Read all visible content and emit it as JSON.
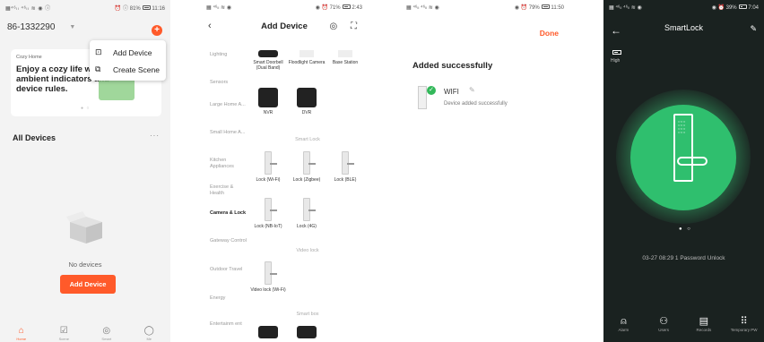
{
  "screen1": {
    "status_left": "▦⁴⁶ₗₗ ⁴⁶ₗₗ ≋ ◉ ⓘ",
    "status_right": "⏰ ⓘ 81%",
    "home_name": "86-1332290",
    "caret": "▼",
    "plus": "+",
    "menu": [
      {
        "icon": "⊡",
        "label": "Add Device"
      },
      {
        "icon": "⧉",
        "label": "Create Scene"
      }
    ],
    "status_time": "11:16",
    "card_tag": "Cozy Home",
    "card_text": "Enjoy a cozy life with ambient indicators and device rules.",
    "card_dots": "● ○",
    "all_devices": "All Devices",
    "more": "···",
    "no_devices": "No devices",
    "add_device_btn": "Add Device",
    "tabs": [
      {
        "label": "Home",
        "icon": "⌂"
      },
      {
        "label": "Scene",
        "icon": "☑"
      },
      {
        "label": "Smart",
        "icon": "◎"
      },
      {
        "label": "Me",
        "icon": "◯"
      }
    ]
  },
  "screen2": {
    "status_left": "▦ ⁴⁶ₗₗ ≋ ◉",
    "status_right": "◉ ⏰ 71%",
    "status_time": "2:43",
    "back": "‹",
    "title": "Add Device",
    "icons": "◎ ⛶",
    "categories": [
      "Lighting",
      "Sensors",
      "Large Home A...",
      "Small Home A...",
      "Kitchen Appliances",
      "Exercise & Health",
      "Camera & Lock",
      "Gateway Control",
      "Outdoor Travel",
      "Energy",
      "Entertainm ent"
    ],
    "devices_top": [
      "Smart Doorbell (Dual Band)",
      "Floodlight Camera",
      "Base Station"
    ],
    "devices_cam": [
      "NVR",
      "DVR"
    ],
    "section_smartlock": "Smart Lock",
    "locks_row1": [
      "Lock (Wi-Fi)",
      "Lock (Zigbee)",
      "Lock (BLE)"
    ],
    "locks_row2": [
      "Lock (NB-IoT)",
      "Lock (4G)"
    ],
    "section_videolock": "Video lock",
    "videolock": "Video lock (Wi-Fi)",
    "section_smartbox": "Smart box"
  },
  "screen3": {
    "status_left": "▦ ⁴⁶ₗₗ ⁴⁶ₗₗ ≋ ◉",
    "status_right": "◉ ⏰ 79%",
    "status_time": "11:50",
    "done": "Done",
    "added": "Added successfully",
    "check": "✓",
    "device_name": "WIFI",
    "pencil": "✎",
    "device_sub": "Device added successfully"
  },
  "screen4": {
    "status_left": "▦ ⁴⁶ₗₗ ⁴⁶ₗₗ ≋ ◉",
    "status_right": "◉ ⏰ 39%",
    "status_time": "7:04",
    "back": "←",
    "title": "SmartLock",
    "edit": "✎",
    "battery_level": "High",
    "keypad": "○○○ ○○○ ○○○ ○○○",
    "page_dots": "● ○",
    "unlock_log": "03-27 08:29  1 Password Unlock",
    "tabs": [
      {
        "label": "Alarm",
        "icon": "⍝"
      },
      {
        "label": "Users",
        "icon": "⚇"
      },
      {
        "label": "Records",
        "icon": "▤"
      },
      {
        "label": "Temporary PW",
        "icon": "⠿"
      }
    ]
  }
}
